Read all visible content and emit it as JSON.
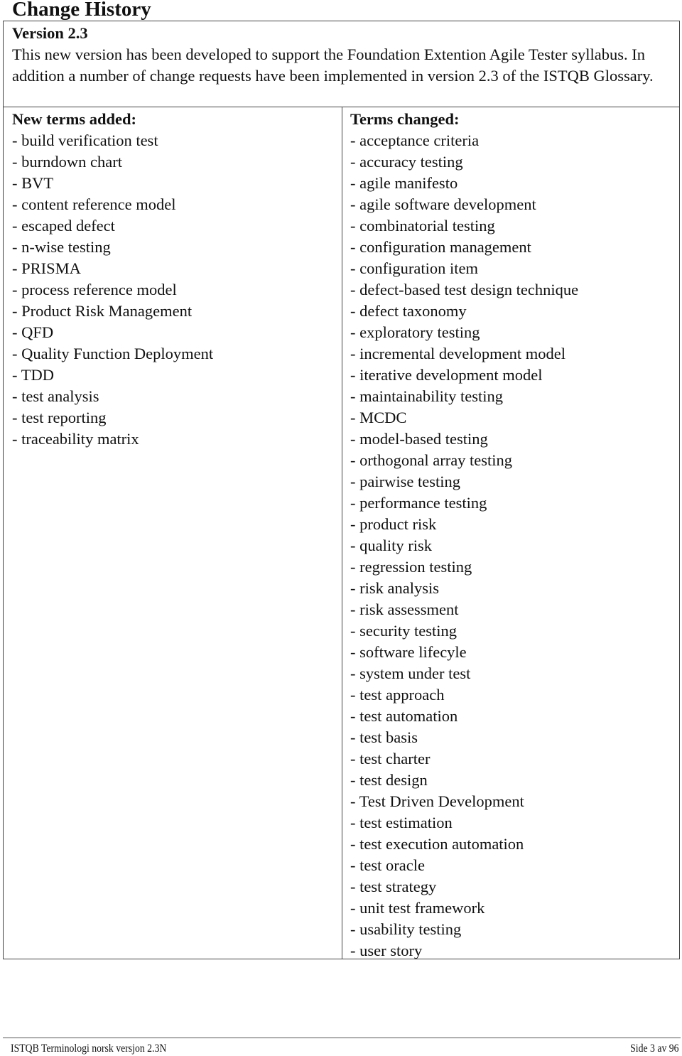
{
  "page": {
    "title": "Change History"
  },
  "version": {
    "title": "Version 2.3",
    "description": "This new version has been developed to support the Foundation Extention Agile Tester syllabus. In addition a number of change requests have been implemented in version 2.3 of the ISTQB Glossary."
  },
  "new_terms": {
    "heading": "New terms added:",
    "items": [
      "- build verification test",
      "- burndown chart",
      "- BVT",
      "- content reference model",
      "- escaped defect",
      "- n-wise testing",
      "- PRISMA",
      "- process reference model",
      "- Product Risk Management",
      "- QFD",
      "- Quality Function Deployment",
      "- TDD",
      "- test analysis",
      "- test reporting",
      "- traceability matrix"
    ]
  },
  "changed_terms": {
    "heading": "Terms changed:",
    "items": [
      "- acceptance criteria",
      "- accuracy testing",
      "- agile manifesto",
      "- agile software development",
      "- combinatorial testing",
      "- configuration management",
      "- configuration item",
      "- defect-based test design technique",
      "- defect taxonomy",
      "- exploratory testing",
      "- incremental development model",
      "- iterative development model",
      "- maintainability testing",
      "- MCDC",
      "- model-based testing",
      "- orthogonal array testing",
      "- pairwise testing",
      "- performance testing",
      "- product risk",
      "- quality risk",
      "- regression testing",
      "- risk analysis",
      "- risk assessment",
      "- security testing",
      "- software lifecyle",
      "- system under test",
      "- test approach",
      "- test automation",
      "- test basis",
      "- test charter",
      "- test design",
      "- Test Driven Development",
      "- test estimation",
      "- test execution automation",
      "- test oracle",
      "- test strategy",
      "- unit test framework",
      "- usability testing",
      "- user story"
    ]
  },
  "footer": {
    "left": "ISTQB Terminologi norsk versjon 2.3N",
    "right": "Side 3 av 96"
  }
}
